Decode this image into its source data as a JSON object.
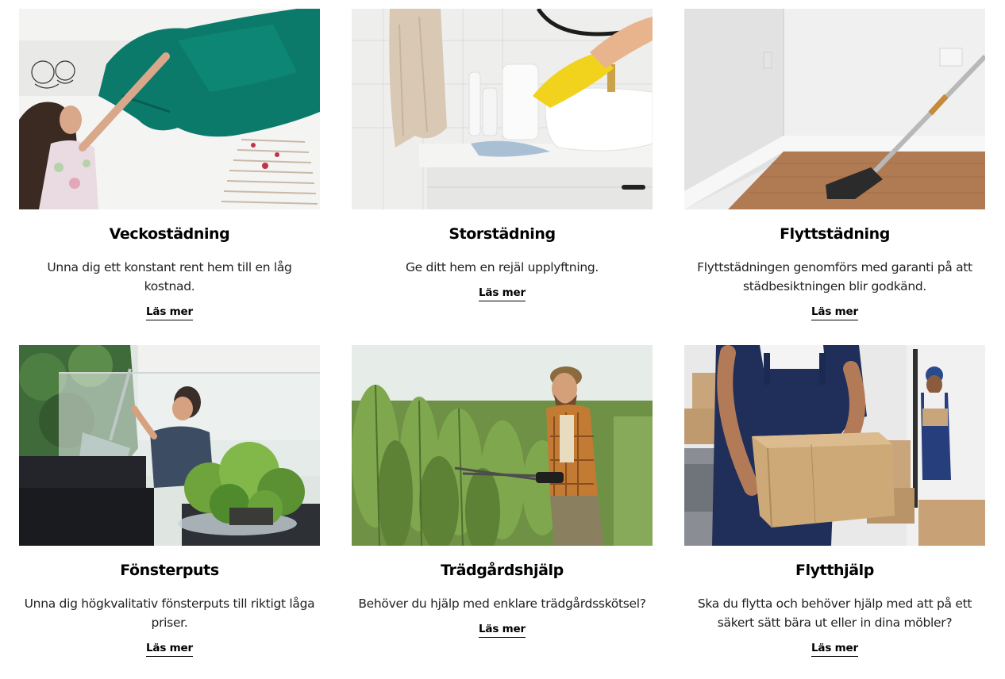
{
  "services": [
    {
      "title": "Veckostädning",
      "description": "Unna dig ett konstant rent hem till en låg kostnad.",
      "link_label": "Läs mer"
    },
    {
      "title": "Storstädning",
      "description": "Ge ditt hem en rejäl upplyftning.",
      "link_label": "Läs mer"
    },
    {
      "title": "Flyttstädning",
      "description": "Flyttstädningen genomförs med garanti på att städbesiktningen blir godkänd.",
      "link_label": "Läs mer"
    },
    {
      "title": "Fönsterputs",
      "description": "Unna dig högkvalitativ fönsterputs till riktigt låga priser.",
      "link_label": "Läs mer"
    },
    {
      "title": "Trädgårdshjälp",
      "description": "Behöver du hjälp med enklare trädgårdsskötsel?",
      "link_label": "Läs mer"
    },
    {
      "title": "Flytthjälp",
      "description": "Ska du flytta och behöver hjälp med att på ett säkert sätt bära ut eller in dina möbler?",
      "link_label": "Läs mer"
    }
  ]
}
